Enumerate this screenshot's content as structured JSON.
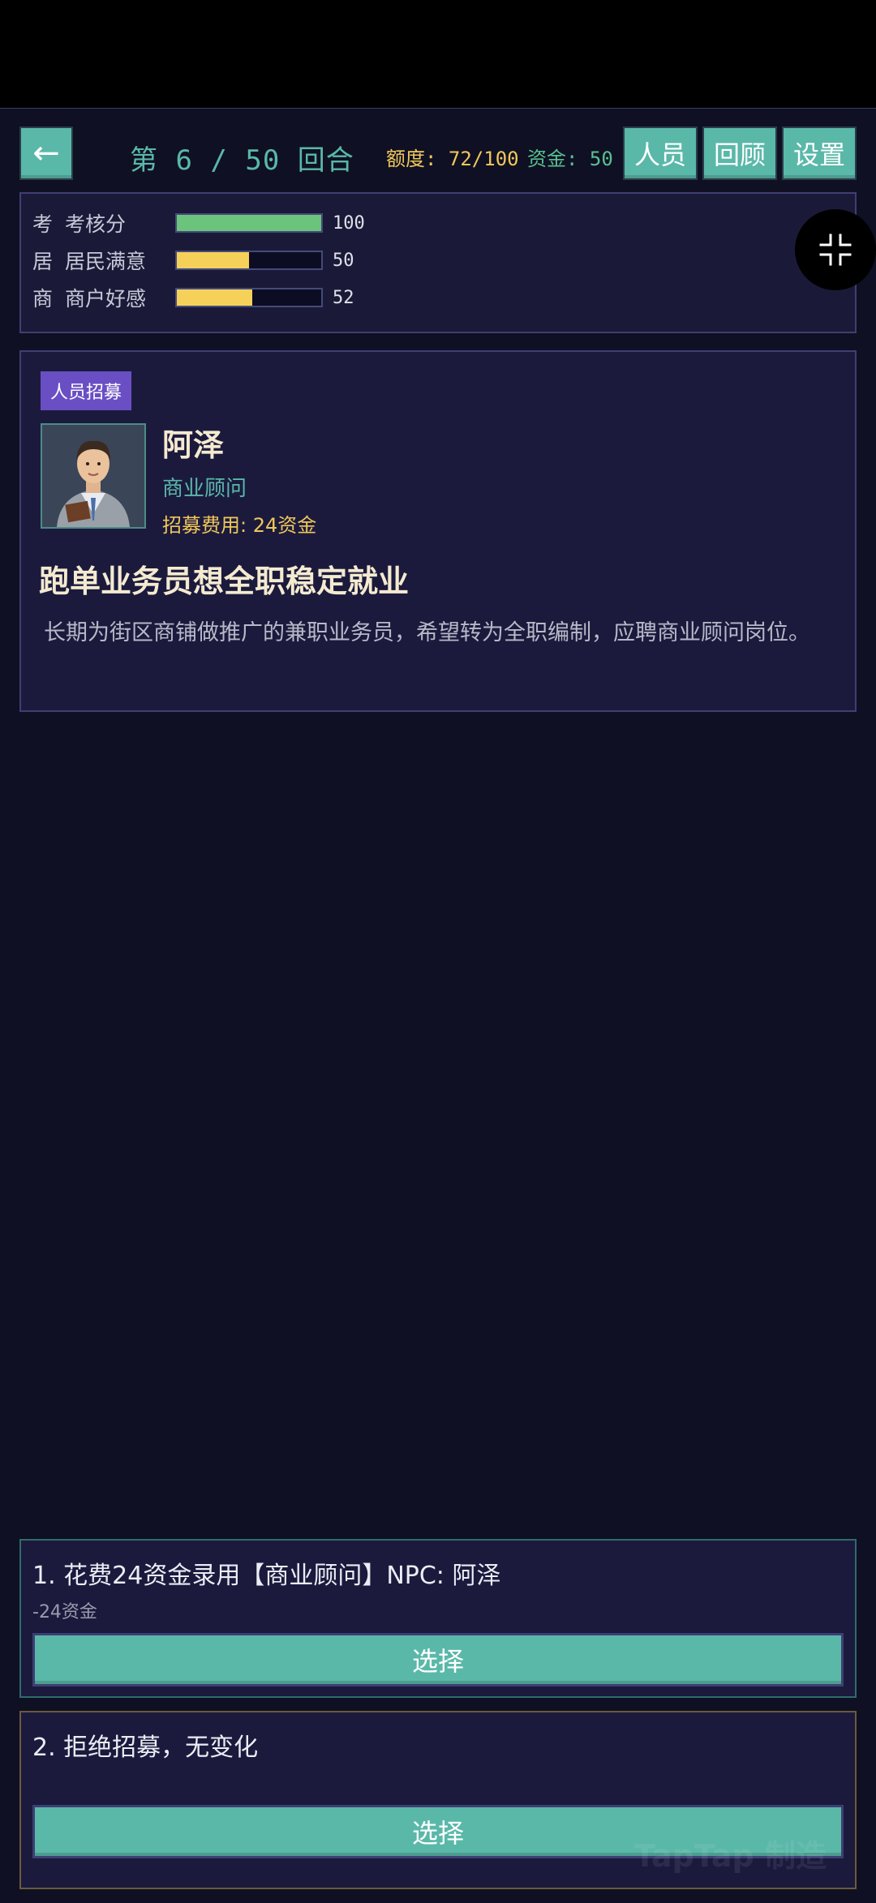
{
  "header": {
    "back_icon": "←",
    "round_text": "第 6 / 50 回合",
    "quota_label": "额度: 72/100",
    "funds_label": "资金: 50",
    "staff_label": "人员",
    "review_label": "回顾",
    "settings_label": "设置"
  },
  "stats": [
    {
      "short": "考",
      "label": "考核分",
      "value": "100",
      "fraction": 1.0,
      "color": "#6cc47c"
    },
    {
      "short": "居",
      "label": "居民满意",
      "value": "50",
      "fraction": 0.5,
      "color": "#f5d15a"
    },
    {
      "short": "商",
      "label": "商户好感",
      "value": "52",
      "fraction": 0.52,
      "color": "#f5d15a"
    }
  ],
  "event": {
    "tag": "人员招募",
    "npc_name": "阿泽",
    "npc_role": "商业顾问",
    "npc_cost": "招募费用: 24资金",
    "title": "跑单业务员想全职稳定就业",
    "description": "长期为街区商铺做推广的兼职业务员，希望转为全职编制，应聘商业顾问岗位。"
  },
  "choices": [
    {
      "text": "1. 花费24资金录用【商业顾问】NPC: 阿泽",
      "effect": "-24资金",
      "button": "选择"
    },
    {
      "text": "2. 拒绝招募，无变化",
      "effect": "",
      "button": "选择"
    }
  ],
  "watermark": "TapTap 制造",
  "colors": {
    "background": "#0f1023",
    "panel": "#1b1a3d",
    "accent_teal": "#5ab8a9",
    "accent_yellow": "#f0c75a",
    "accent_green": "#59c08f",
    "tag_purple": "#6a4fc4"
  }
}
